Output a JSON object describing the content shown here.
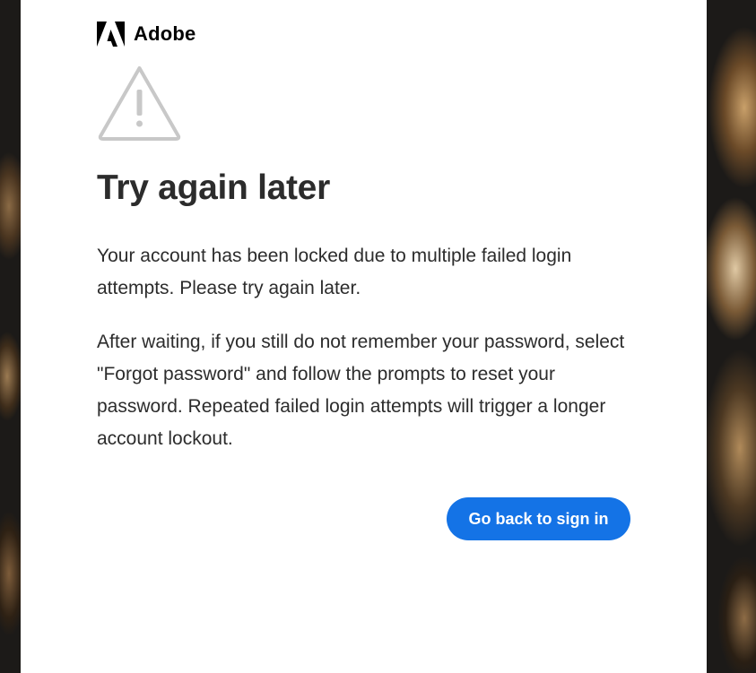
{
  "brand": {
    "name": "Adobe"
  },
  "icons": {
    "logo": "adobe-logo-icon",
    "warning": "warning-triangle-icon"
  },
  "colors": {
    "accent": "#1473e6",
    "text": "#2c2c2c",
    "icon_gray": "#c8c8c8",
    "card": "#ffffff"
  },
  "page": {
    "title": "Try again later",
    "paragraph1": "Your account has been locked due to multiple failed login attempts. Please try again later.",
    "paragraph2": "After waiting, if you still do not remember your password, select \"Forgot password\" and follow the prompts to reset your password. Repeated failed login attempts will trigger a longer account lockout."
  },
  "actions": {
    "back_label": "Go back to sign in"
  }
}
